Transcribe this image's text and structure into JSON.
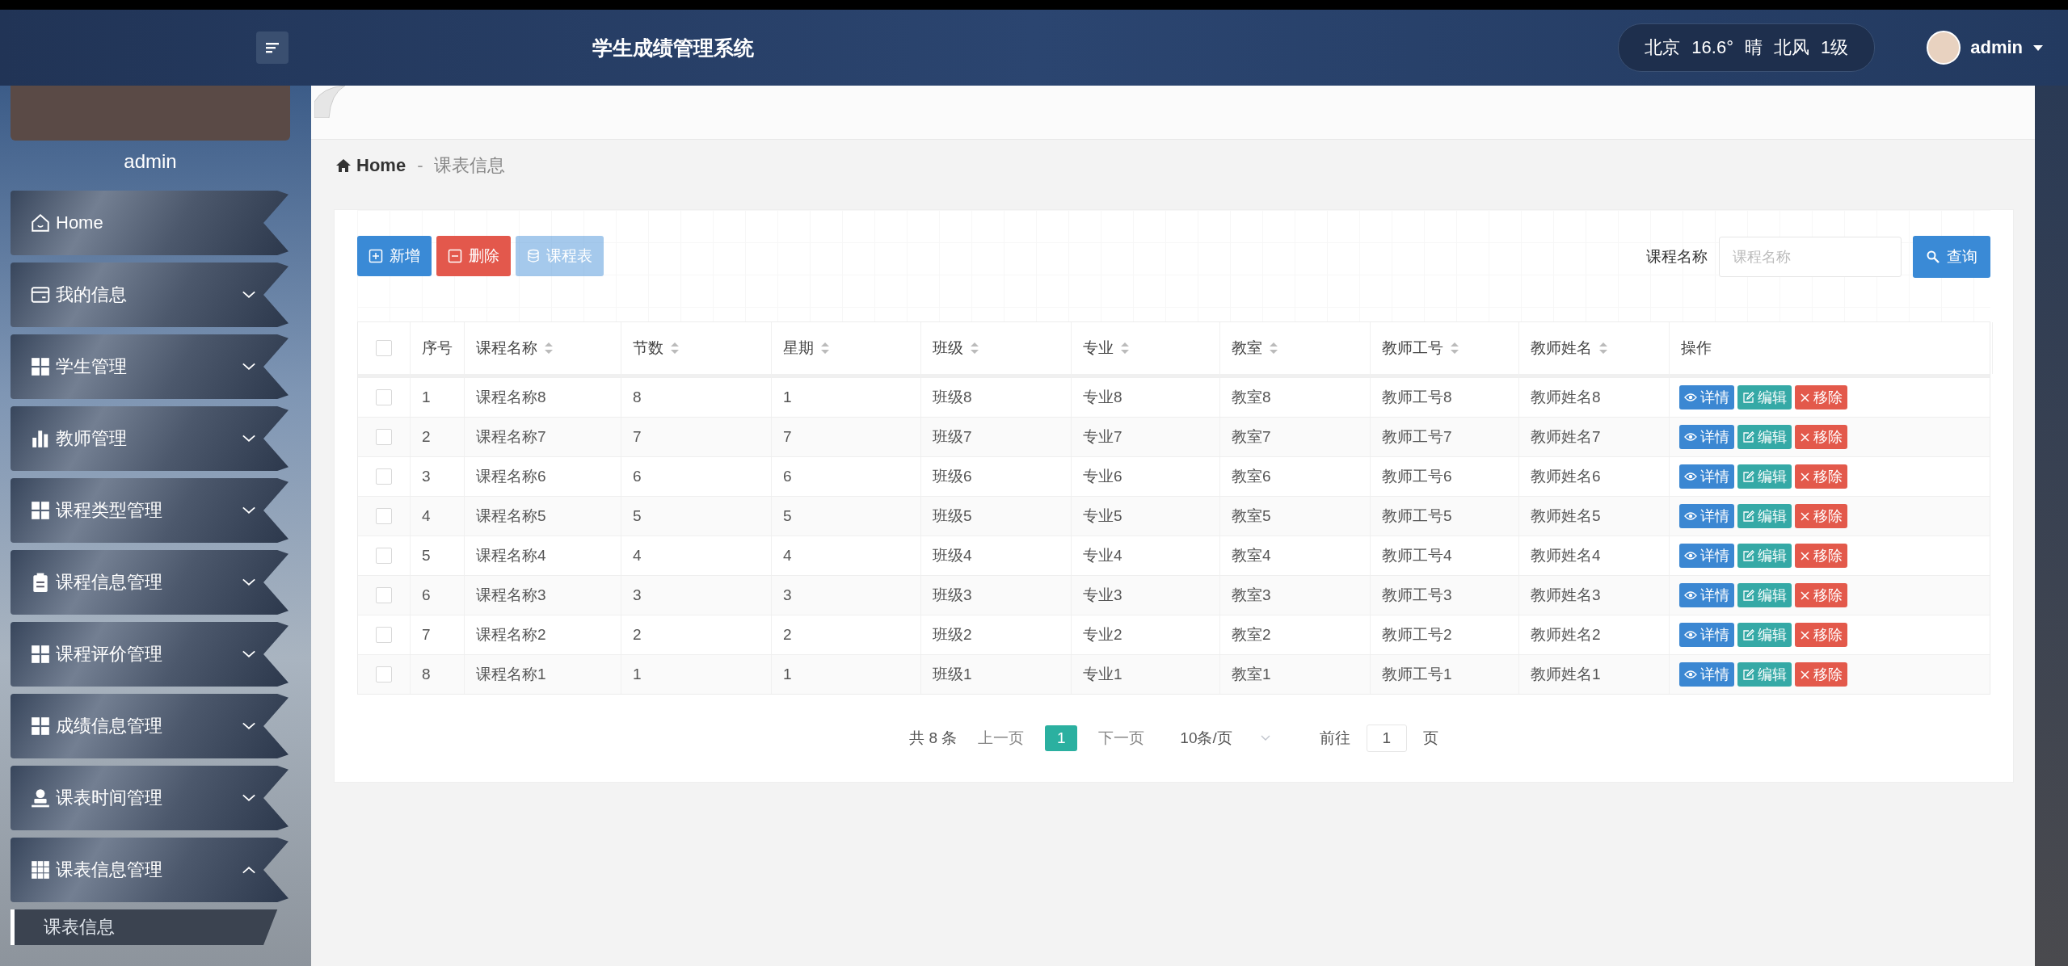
{
  "header": {
    "title": "学生成绩管理系统",
    "weather": {
      "city": "北京",
      "temperature": "16.6°",
      "condition": "晴",
      "wind": "北风",
      "wind_force": "1级"
    },
    "user": "admin"
  },
  "sidebar": {
    "username": "admin",
    "items": [
      {
        "label": "Home",
        "kind": "link",
        "expanded": false
      },
      {
        "label": "我的信息",
        "kind": "group",
        "expanded": false
      },
      {
        "label": "学生管理",
        "kind": "group",
        "expanded": false
      },
      {
        "label": "教师管理",
        "kind": "group",
        "expanded": false
      },
      {
        "label": "课程类型管理",
        "kind": "group",
        "expanded": false
      },
      {
        "label": "课程信息管理",
        "kind": "group",
        "expanded": false
      },
      {
        "label": "课程评价管理",
        "kind": "group",
        "expanded": false
      },
      {
        "label": "成绩信息管理",
        "kind": "group",
        "expanded": false
      },
      {
        "label": "课表时间管理",
        "kind": "group",
        "expanded": false
      },
      {
        "label": "课表信息管理",
        "kind": "group",
        "expanded": true,
        "children": [
          {
            "label": "课表信息",
            "selected": true
          }
        ]
      }
    ]
  },
  "breadcrumb": {
    "home": "Home",
    "separator": "-",
    "current": "课表信息"
  },
  "toolbar": {
    "buttons": [
      {
        "label": "新增",
        "kind": "add",
        "disabled": false
      },
      {
        "label": "删除",
        "kind": "delete",
        "disabled": false
      },
      {
        "label": "课程表",
        "kind": "schedule",
        "disabled": true
      }
    ],
    "search": {
      "label": "课程名称",
      "placeholder": "课程名称",
      "button": "查询"
    }
  },
  "table": {
    "all_checked": false,
    "columns": [
      {
        "label": "序号",
        "sortable": false
      },
      {
        "label": "课程名称",
        "sortable": true
      },
      {
        "label": "节数",
        "sortable": true
      },
      {
        "label": "星期",
        "sortable": true
      },
      {
        "label": "班级",
        "sortable": true
      },
      {
        "label": "专业",
        "sortable": true
      },
      {
        "label": "教室",
        "sortable": true
      },
      {
        "label": "教师工号",
        "sortable": true
      },
      {
        "label": "教师姓名",
        "sortable": true
      },
      {
        "label": "操作",
        "sortable": false
      }
    ],
    "rows": [
      {
        "checked": false,
        "cells": [
          "1",
          "课程名称8",
          "8",
          "1",
          "班级8",
          "专业8",
          "教室8",
          "教师工号8",
          "教师姓名8"
        ],
        "actions": [
          {
            "label": "详情",
            "kind": "view"
          },
          {
            "label": "编辑",
            "kind": "edit"
          },
          {
            "label": "移除",
            "kind": "remove"
          }
        ]
      },
      {
        "checked": false,
        "cells": [
          "2",
          "课程名称7",
          "7",
          "7",
          "班级7",
          "专业7",
          "教室7",
          "教师工号7",
          "教师姓名7"
        ],
        "actions": [
          {
            "label": "详情",
            "kind": "view"
          },
          {
            "label": "编辑",
            "kind": "edit"
          },
          {
            "label": "移除",
            "kind": "remove"
          }
        ]
      },
      {
        "checked": false,
        "cells": [
          "3",
          "课程名称6",
          "6",
          "6",
          "班级6",
          "专业6",
          "教室6",
          "教师工号6",
          "教师姓名6"
        ],
        "actions": [
          {
            "label": "详情",
            "kind": "view"
          },
          {
            "label": "编辑",
            "kind": "edit"
          },
          {
            "label": "移除",
            "kind": "remove"
          }
        ]
      },
      {
        "checked": false,
        "cells": [
          "4",
          "课程名称5",
          "5",
          "5",
          "班级5",
          "专业5",
          "教室5",
          "教师工号5",
          "教师姓名5"
        ],
        "actions": [
          {
            "label": "详情",
            "kind": "view"
          },
          {
            "label": "编辑",
            "kind": "edit"
          },
          {
            "label": "移除",
            "kind": "remove"
          }
        ]
      },
      {
        "checked": false,
        "cells": [
          "5",
          "课程名称4",
          "4",
          "4",
          "班级4",
          "专业4",
          "教室4",
          "教师工号4",
          "教师姓名4"
        ],
        "actions": [
          {
            "label": "详情",
            "kind": "view"
          },
          {
            "label": "编辑",
            "kind": "edit"
          },
          {
            "label": "移除",
            "kind": "remove"
          }
        ]
      },
      {
        "checked": false,
        "cells": [
          "6",
          "课程名称3",
          "3",
          "3",
          "班级3",
          "专业3",
          "教室3",
          "教师工号3",
          "教师姓名3"
        ],
        "actions": [
          {
            "label": "详情",
            "kind": "view"
          },
          {
            "label": "编辑",
            "kind": "edit"
          },
          {
            "label": "移除",
            "kind": "remove"
          }
        ]
      },
      {
        "checked": false,
        "cells": [
          "7",
          "课程名称2",
          "2",
          "2",
          "班级2",
          "专业2",
          "教室2",
          "教师工号2",
          "教师姓名2"
        ],
        "actions": [
          {
            "label": "详情",
            "kind": "view"
          },
          {
            "label": "编辑",
            "kind": "edit"
          },
          {
            "label": "移除",
            "kind": "remove"
          }
        ]
      },
      {
        "checked": false,
        "cells": [
          "8",
          "课程名称1",
          "1",
          "1",
          "班级1",
          "专业1",
          "教室1",
          "教师工号1",
          "教师姓名1"
        ],
        "actions": [
          {
            "label": "详情",
            "kind": "view"
          },
          {
            "label": "编辑",
            "kind": "edit"
          },
          {
            "label": "移除",
            "kind": "remove"
          }
        ]
      }
    ]
  },
  "pagination": {
    "total": "共 8 条",
    "prev": "上一页",
    "pages": [
      {
        "label": "1",
        "selected": true
      }
    ],
    "next": "下一页",
    "page_size": "10条/页",
    "goto_label": "前往",
    "goto_value": "1",
    "goto_suffix": "页"
  }
}
